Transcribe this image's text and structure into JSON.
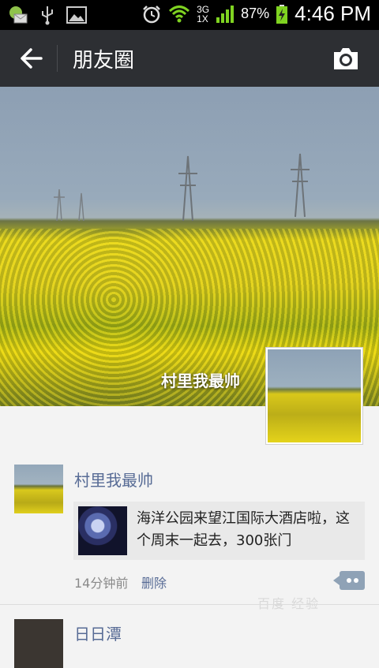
{
  "status": {
    "network_top": "3G",
    "network_bottom": "1X",
    "battery": "87%",
    "time": "4:46 PM"
  },
  "appbar": {
    "title": "朋友圈"
  },
  "cover": {
    "owner_name": "村里我最帅"
  },
  "posts": [
    {
      "author": "村里我最帅",
      "shared_text": "海洋公园来望江国际大酒店啦，这个周末一起去，300张门",
      "time": "14分钟前",
      "delete_label": "删除"
    }
  ],
  "next_post": {
    "author": "日日潭"
  },
  "watermark": "百度 经验"
}
